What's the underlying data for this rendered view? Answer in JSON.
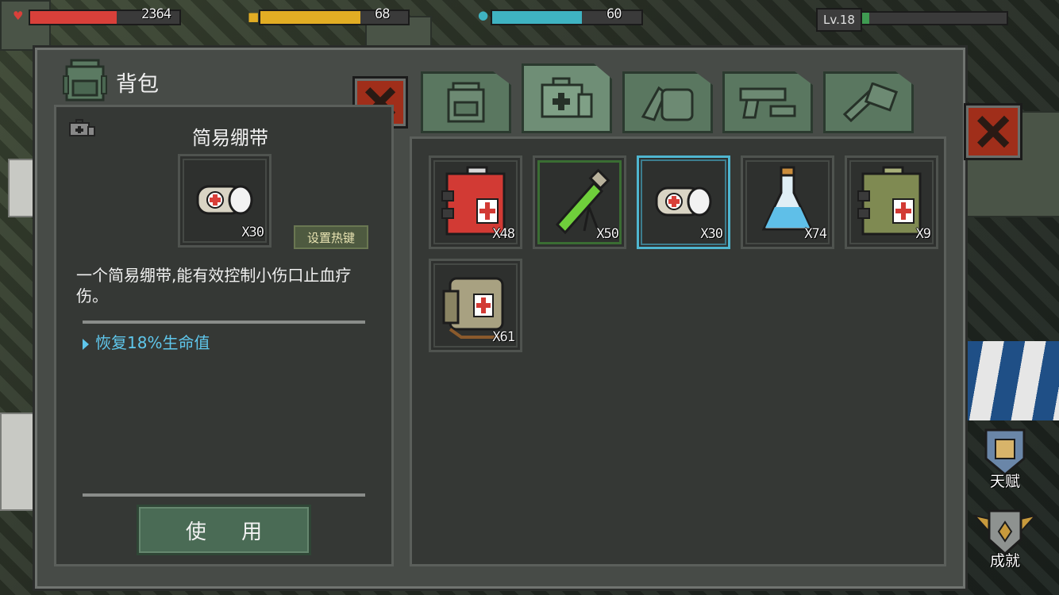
{
  "hud": {
    "health": "2364",
    "health_fraction": 0.58,
    "food": "68",
    "food_fraction": 0.68,
    "water": "60",
    "water_fraction": 0.6,
    "level": "Lv.18",
    "xp_fraction": 0.05
  },
  "panel": {
    "title": "背包",
    "tabs": [
      {
        "name": "backpack",
        "icon": "backpack-icon"
      },
      {
        "name": "medical",
        "icon": "medkit-icon",
        "active": true
      },
      {
        "name": "food",
        "icon": "food-icon"
      },
      {
        "name": "weapons",
        "icon": "pistol-icon"
      },
      {
        "name": "tools",
        "icon": "wrench-icon"
      }
    ]
  },
  "detail": {
    "name": "简易绷带",
    "count": "X30",
    "hotkey_label": "设置热键",
    "description": "一个简易绷带,能有效控制小伤口止血疗伤。",
    "effect": "恢复18%生命值",
    "use_label": "使 用"
  },
  "items": [
    {
      "icon": "first-aid-kit-icon",
      "count": "X48"
    },
    {
      "icon": "green-syringe-icon",
      "count": "X50"
    },
    {
      "icon": "bandage-icon",
      "count": "X30",
      "selected": true
    },
    {
      "icon": "blue-potion-icon",
      "count": "X74"
    },
    {
      "icon": "military-medkit-icon",
      "count": "X9"
    },
    {
      "icon": "medic-bag-icon",
      "count": "X61"
    }
  ],
  "side_buttons": {
    "talent": "天赋",
    "achievement": "成就"
  },
  "colors": {
    "health": "#d9403a",
    "food": "#e2ad24",
    "water": "#3fb3c2",
    "xp": "#3f9b52",
    "close": "#a02e1a",
    "effect_text": "#5fc7ec",
    "selected_border": "#4fb6d0"
  }
}
